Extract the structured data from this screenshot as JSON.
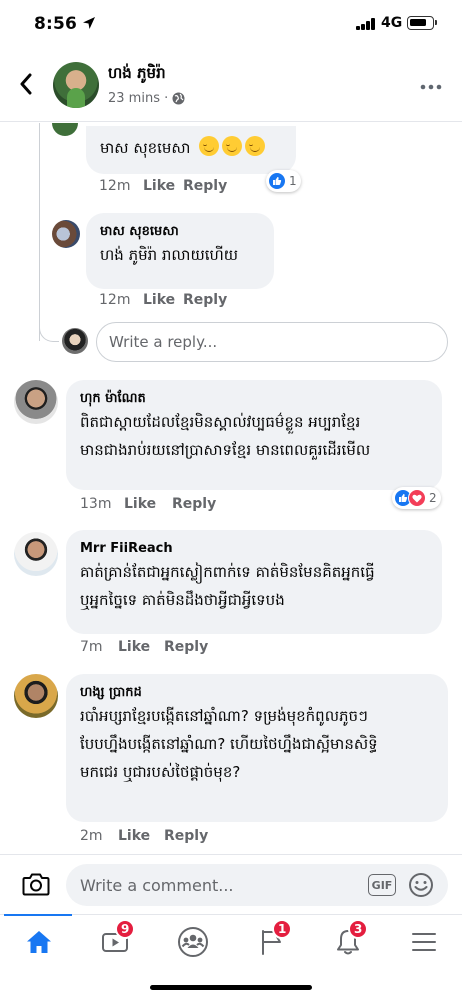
{
  "status_bar": {
    "time": "8:56",
    "network": "4G",
    "battery_level": 0.8
  },
  "header": {
    "name": "ហង់ ភូមិរ៉ា",
    "meta": "23 mins ·"
  },
  "replies": [
    {
      "text": "មាស សុខមេសា",
      "time": "12m",
      "like_label": "Like",
      "reply_label": "Reply",
      "reaction_count": "1"
    },
    {
      "author": "មាស សុខមេសា",
      "text": "ហង់ ភូមិរ៉ា រាលាយហើយ",
      "time": "12m",
      "like_label": "Like",
      "reply_label": "Reply"
    }
  ],
  "reply_input": {
    "placeholder": "Write a reply..."
  },
  "comments": [
    {
      "author": "ហុក ម៉ាណែត",
      "lines": [
        "ពិតជាស្តាយដែលខ្មែរមិនស្គាល់វប្បធម៌ខ្លួន អប្បរាខ្មែរ",
        "មានជាងរាប់រយនៅប្រាសាទខ្មែរ មានពេលគួរដើរមើល"
      ],
      "time": "13m",
      "like_label": "Like",
      "reply_label": "Reply",
      "reaction_count": "2"
    },
    {
      "author": "Mrr FiiReach",
      "lines": [
        "គាត់គ្រាន់តែជាអ្នកស្លៀកពាក់ទេ គាត់មិនមែនគិតអ្នកធ្វើ",
        "ឬអ្នកច្នៃទេ គាត់មិនដឹងថាអ្វីជាអ្វីទេបង"
      ],
      "time": "7m",
      "like_label": "Like",
      "reply_label": "Reply"
    },
    {
      "author": "ហង្ស ប្រាកដ",
      "lines": [
        "របាំអប្សរាខ្មែរបង្កើតនៅឆ្នាំណា? ទម្រង់មុខកំពូលភូចៗ",
        "បែបហ្នឹងបង្កើតនៅឆ្នាំណា? ហើយថៃហ្នឹងជាស្អីមានសិទ្ធិ",
        "មកជេរ ឬជារបស់ថៃផ្តាច់មុខ?"
      ],
      "time": "2m",
      "like_label": "Like",
      "reply_label": "Reply"
    }
  ],
  "composer": {
    "placeholder": "Write a comment...",
    "gif_label": "GIF"
  },
  "tabbar": {
    "items": [
      {
        "icon": "home-icon",
        "badge": ""
      },
      {
        "icon": "watch-icon",
        "badge": "9"
      },
      {
        "icon": "groups-icon",
        "badge": ""
      },
      {
        "icon": "pages-flag-icon",
        "badge": "1"
      },
      {
        "icon": "notifications-bell-icon",
        "badge": "3"
      },
      {
        "icon": "menu-icon",
        "badge": ""
      }
    ]
  },
  "colors": {
    "accent": "#1877f2",
    "bubble": "#f0f2f5",
    "badge": "#e41e3f",
    "muted_text": "#65676b"
  }
}
